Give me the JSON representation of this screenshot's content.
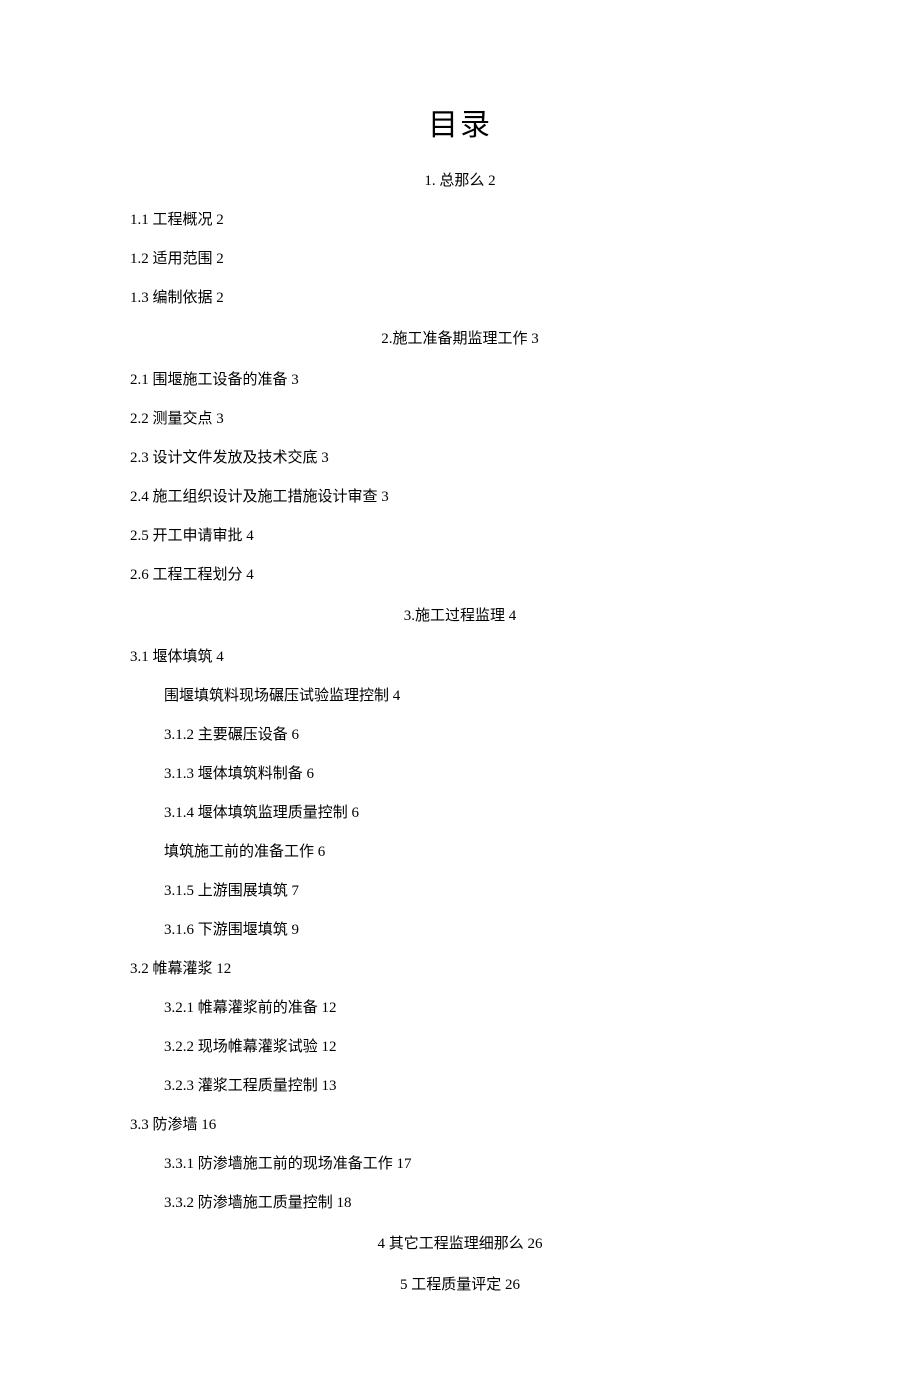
{
  "title": "目录",
  "entries": [
    {
      "type": "centered",
      "text": "1. 总那么 2"
    },
    {
      "type": "l1",
      "text": "1.1 工程概况 2"
    },
    {
      "type": "l1",
      "text": "1.2 适用范围 2"
    },
    {
      "type": "l1",
      "text": "1.3 编制依据 2"
    },
    {
      "type": "section",
      "text": "2.施工准备期监理工作 3"
    },
    {
      "type": "l1",
      "text": "2.1 围堰施工设备的准备 3"
    },
    {
      "type": "l1",
      "text": "2.2 测量交点 3"
    },
    {
      "type": "l1",
      "text": "2.3 设计文件发放及技术交底 3"
    },
    {
      "type": "l1",
      "text": "2.4 施工组织设计及施工措施设计审查 3"
    },
    {
      "type": "l1",
      "text": "2.5 开工申请审批 4"
    },
    {
      "type": "l1",
      "text": "2.6 工程工程划分 4"
    },
    {
      "type": "section",
      "text": "3.施工过程监理 4"
    },
    {
      "type": "l1",
      "text": "3.1 堰体填筑 4"
    },
    {
      "type": "l2",
      "text": "围堰填筑料现场碾压试验监理控制 4"
    },
    {
      "type": "l2",
      "text": "3.1.2 主要碾压设备 6"
    },
    {
      "type": "l2",
      "text": "3.1.3 堰体填筑料制备 6"
    },
    {
      "type": "l2",
      "text": "3.1.4 堰体填筑监理质量控制 6"
    },
    {
      "type": "l2",
      "text": "填筑施工前的准备工作 6"
    },
    {
      "type": "l2",
      "text": "3.1.5 上游围展填筑 7"
    },
    {
      "type": "l2",
      "text": "3.1.6 下游围堰填筑 9"
    },
    {
      "type": "l1",
      "text": "3.2 帷幕灌浆 12"
    },
    {
      "type": "l2",
      "text": "3.2.1 帷幕灌浆前的准备 12"
    },
    {
      "type": "l2",
      "text": "3.2.2 现场帷幕灌浆试验 12"
    },
    {
      "type": "l2",
      "text": "3.2.3 灌浆工程质量控制 13"
    },
    {
      "type": "l1",
      "text": "3.3 防渗墙 16"
    },
    {
      "type": "l2",
      "text": "3.3.1 防渗墙施工前的现场准备工作 17"
    },
    {
      "type": "l2",
      "text": "3.3.2 防渗墙施工质量控制 18"
    },
    {
      "type": "section",
      "text": "4 其它工程监理细那么 26"
    },
    {
      "type": "section",
      "text": "5 工程质量评定 26"
    }
  ]
}
